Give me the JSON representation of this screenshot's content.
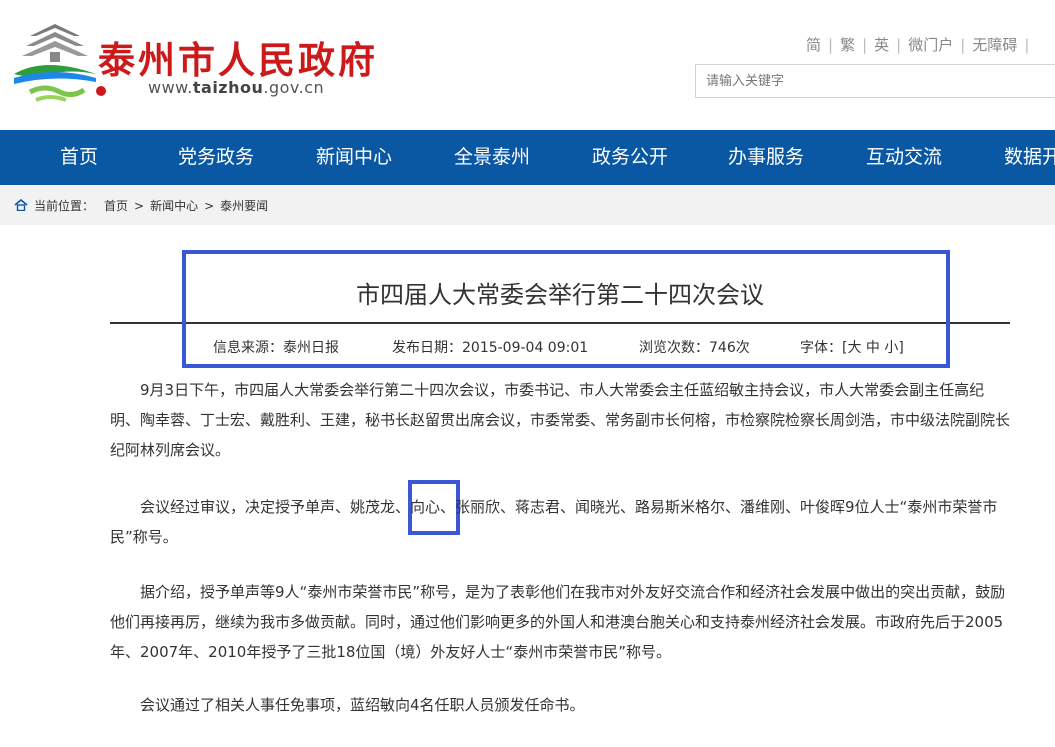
{
  "site": {
    "name": "泰州市人民政府",
    "url_prefix": "www.",
    "url_bold": "taizhou",
    "url_suffix": ".gov.cn"
  },
  "top_links": [
    "简",
    "繁",
    "英",
    "微门户",
    "无障碍"
  ],
  "search": {
    "placeholder": "请输入关键字"
  },
  "nav": [
    "首页",
    "党务政务",
    "新闻中心",
    "全景泰州",
    "政务公开",
    "办事服务",
    "互动交流",
    "数据开"
  ],
  "breadcrumb": {
    "label": "当前位置：",
    "items": [
      "首页",
      "新闻中心",
      "泰州要闻"
    ],
    "separator": ">"
  },
  "article": {
    "title": "市四届人大常委会举行第二十四次会议",
    "meta": {
      "source": "信息来源：泰州日报",
      "date": "发布日期：2015-09-04 09:01",
      "views": "浏览次数：746次",
      "font_label": "字体：",
      "font_sizes": "[大 中 小]"
    },
    "paragraphs": [
      "9月3日下午，市四届人大常委会举行第二十四次会议，市委书记、市人大常委会主任蓝绍敏主持会议，市人大常委会副主任高纪明、陶幸蓉、丁士宏、戴胜利、王建，秘书长赵留贯出席会议，市委常委、常务副市长何榕，市检察院检察长周剑浩，市中级法院副院长纪阿林列席会议。",
      "会议经过审议，决定授予单声、姚茂龙、向心、张丽欣、蒋志君、闻晓光、路易斯米格尔、潘维刚、叶俊晖9位人士“泰州市荣誉市民”称号。",
      "据介绍，授予单声等9人“泰州市荣誉市民”称号，是为了表彰他们在我市对外友好交流合作和经济社会发展中做出的突出贡献，鼓励他们再接再厉，继续为我市多做贡献。同时，通过他们影响更多的外国人和港澳台胞关心和支持泰州经济社会发展。市政府先后于2005年、2007年、2010年授予了三批18位国（境）外友好人士“泰州市荣誉市民”称号。",
      "会议通过了相关人事任免事项，蓝绍敏向4名任职人员颁发任命书。"
    ]
  },
  "colors": {
    "brand_red": "#cc1a1a",
    "nav_blue": "#0a57a3",
    "highlight_blue": "#3b57d6"
  }
}
